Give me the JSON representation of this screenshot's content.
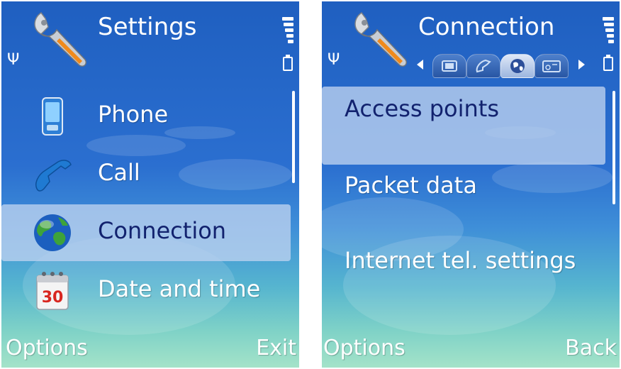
{
  "left": {
    "title": "Settings",
    "items": [
      {
        "label": "Phone",
        "icon": "phone-icon"
      },
      {
        "label": "Call",
        "icon": "call-handset-icon"
      },
      {
        "label": "Connection",
        "icon": "globe-icon",
        "selected": true
      },
      {
        "label": "Date and time",
        "icon": "calendar-icon",
        "calendar_day": "30"
      }
    ],
    "softkeys": {
      "left": "Options",
      "right": "Exit"
    }
  },
  "right": {
    "title": "Connection",
    "tabs": [
      "phone-tab-icon",
      "call-tab-icon",
      "connection-tab-icon",
      "device-tab-icon"
    ],
    "active_tab": 2,
    "items": [
      {
        "label": "Access points",
        "selected": true
      },
      {
        "label": "Packet data"
      },
      {
        "label": "Internet tel. settings"
      }
    ],
    "softkeys": {
      "left": "Options",
      "right": "Back"
    }
  },
  "colors": {
    "selected_text": "#12226e",
    "selection_bg": "#bed2f0",
    "background_top": "#1f5fc0",
    "background_bottom": "#a4e3c9"
  }
}
